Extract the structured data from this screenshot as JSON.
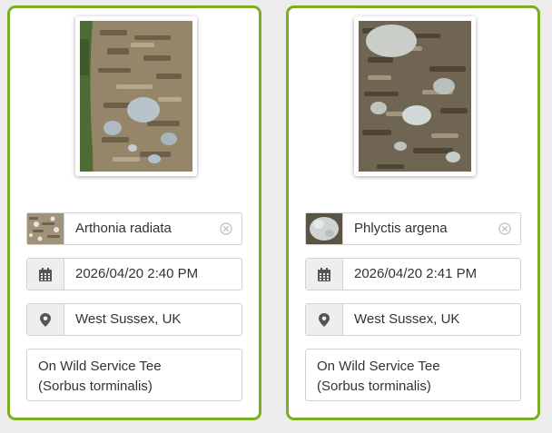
{
  "observations": [
    {
      "species": "Arthonia radiata",
      "datetime": "2026/04/20 2:40 PM",
      "location": "West Sussex, UK",
      "notes": "On Wild Service Tee\n(Sorbus torminalis)"
    },
    {
      "species": "Phlyctis argena",
      "datetime": "2026/04/20 2:41 PM",
      "location": "West Sussex, UK",
      "notes": "On Wild Service Tee\n(Sorbus torminalis)"
    }
  ],
  "icons": {
    "date": "calendar-icon",
    "location": "map-marker-icon",
    "clear": "clear-circle-x-icon"
  },
  "colors": {
    "card_border": "#7aad1f",
    "addon_bg": "#eceeef",
    "page_bg": "#ececec"
  }
}
